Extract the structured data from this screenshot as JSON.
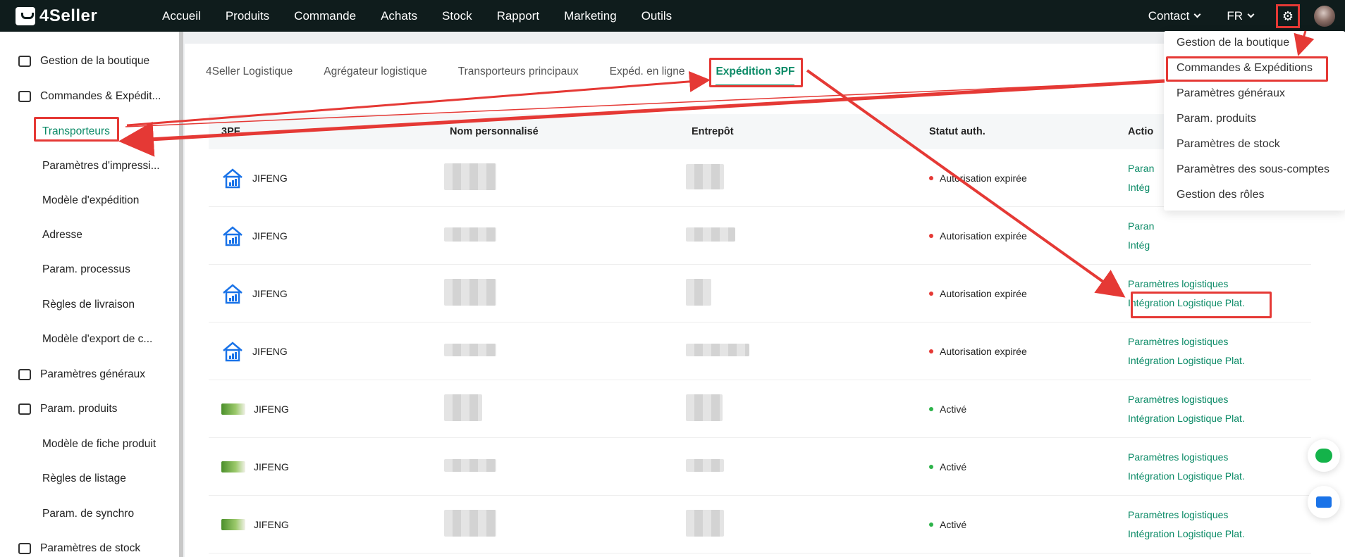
{
  "app": {
    "logo_text": "4Seller"
  },
  "topnav": {
    "items": [
      "Accueil",
      "Produits",
      "Commande",
      "Achats",
      "Stock",
      "Rapport",
      "Marketing",
      "Outils"
    ],
    "contact": "Contact",
    "lang": "FR"
  },
  "sidebar": {
    "items": [
      {
        "label": "Gestion de la boutique",
        "kind": "parent"
      },
      {
        "label": "Commandes & Expédit...",
        "kind": "parent"
      },
      {
        "label": "Transporteurs",
        "kind": "child",
        "active": true
      },
      {
        "label": "Paramètres d'impressi...",
        "kind": "child"
      },
      {
        "label": "Modèle d'expédition",
        "kind": "child"
      },
      {
        "label": "Adresse",
        "kind": "child"
      },
      {
        "label": "Param. processus",
        "kind": "child"
      },
      {
        "label": "Règles de livraison",
        "kind": "child"
      },
      {
        "label": "Modèle d'export de c...",
        "kind": "child"
      },
      {
        "label": "Paramètres généraux",
        "kind": "parent"
      },
      {
        "label": "Param. produits",
        "kind": "parent"
      },
      {
        "label": "Modèle de fiche produit",
        "kind": "child"
      },
      {
        "label": "Règles de listage",
        "kind": "child"
      },
      {
        "label": "Param. de synchro",
        "kind": "child"
      },
      {
        "label": "Paramètres de stock",
        "kind": "parent"
      }
    ]
  },
  "tabs": [
    "4Seller Logistique",
    "Agrégateur logistique",
    "Transporteurs principaux",
    "Expéd. en ligne",
    "Expédition 3PF"
  ],
  "table": {
    "headers": [
      "3PF",
      "Nom personnalisé",
      "Entrepôt",
      "Statut auth.",
      "Actio"
    ],
    "rows": [
      {
        "name": "JIFENG",
        "logo": "house-chart-logo",
        "status": "Autorisation expirée",
        "status_color": "#e53935"
      },
      {
        "name": "JIFENG",
        "logo": "house-chart-logo",
        "status": "Autorisation expirée",
        "status_color": "#e53935"
      },
      {
        "name": "JIFENG",
        "logo": "house-chart-logo",
        "status": "Autorisation expirée",
        "status_color": "#e53935"
      },
      {
        "name": "JIFENG",
        "logo": "house-chart-logo",
        "status": "Autorisation expirée",
        "status_color": "#e53935"
      },
      {
        "name": "JIFENG",
        "logo": "green-banner-logo",
        "status": "Activé",
        "status_color": "#2db34a"
      },
      {
        "name": "JIFENG",
        "logo": "green-banner-logo",
        "status": "Activé",
        "status_color": "#2db34a"
      },
      {
        "name": "JIFENG",
        "logo": "green-banner-logo",
        "status": "Activé",
        "status_color": "#2db34a"
      }
    ],
    "action_1": "Paramètres logistiques",
    "action_2": "Intégration Logistique Plat.",
    "partial_action_1": "Paran",
    "partial_action_2": "Intég"
  },
  "dropdown": {
    "items": [
      "Gestion de la boutique",
      "Commandes & Expéditions",
      "Paramètres généraux",
      "Param. produits",
      "Paramètres de stock",
      "Paramètres des sous-comptes",
      "Gestion des rôles"
    ]
  },
  "colors": {
    "accent": "#0a8a66",
    "annotation": "#e53935",
    "topbar": "#0f1c1c"
  }
}
